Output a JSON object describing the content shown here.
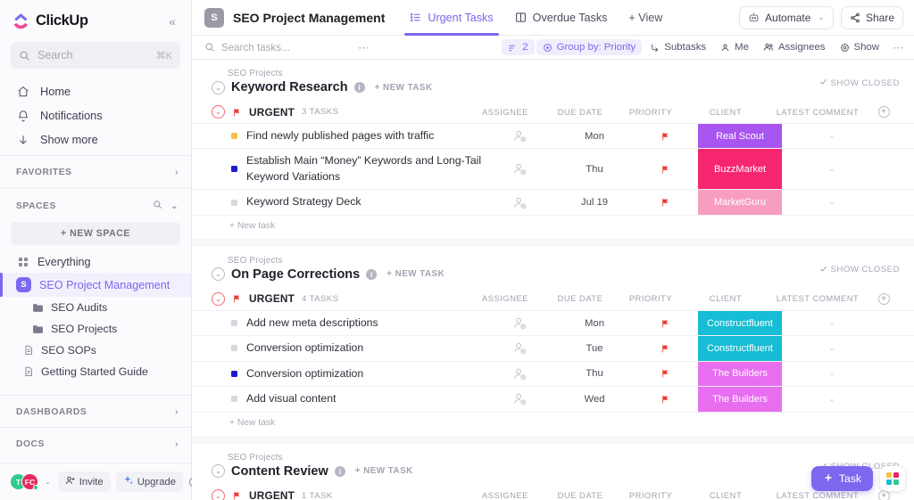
{
  "sidebar": {
    "brand": "ClickUp",
    "collapse_icon": "chevrons-left-icon",
    "search": {
      "placeholder": "Search",
      "shortcut": "⌘K",
      "icon": "search-icon"
    },
    "nav": [
      {
        "label": "Home",
        "icon": "home-icon"
      },
      {
        "label": "Notifications",
        "icon": "bell-icon"
      },
      {
        "label": "Show more",
        "icon": "arrow-down-icon"
      }
    ],
    "favorites": {
      "label": "FAVORITES",
      "chevron": "chevron-right-icon"
    },
    "spaces": {
      "label": "SPACES",
      "search_icon": "search-icon",
      "chevron": "chevron-down-icon",
      "new_space": "+ NEW SPACE",
      "items": [
        {
          "label": "Everything",
          "type": "grid",
          "badge": "",
          "active": false
        },
        {
          "label": "SEO Project Management",
          "type": "space",
          "badge": "S",
          "active": true
        },
        {
          "label": "SEO Audits",
          "type": "folder",
          "active": false
        },
        {
          "label": "SEO Projects",
          "type": "folder",
          "active": false
        },
        {
          "label": "SEO SOPs",
          "type": "doc",
          "active": false
        },
        {
          "label": "Getting Started Guide",
          "type": "doc",
          "active": false
        }
      ]
    },
    "dashboards": {
      "label": "DASHBOARDS",
      "chevron": "chevron-right-icon"
    },
    "docs": {
      "label": "DOCS",
      "chevron": "chevron-right-icon"
    },
    "bottom": {
      "avatars": [
        {
          "initials": "T",
          "color": "#2ecb8b"
        },
        {
          "initials": "FC",
          "color": "#e8275f"
        }
      ],
      "invite_label": "Invite",
      "invite_icon": "user-plus-icon",
      "upgrade_label": "Upgrade",
      "upgrade_icon": "sparkle-icon",
      "help_icon": "help-circle-icon"
    }
  },
  "topbar": {
    "project_badge": "S",
    "project_title": "SEO Project Management",
    "tabs": [
      {
        "label": "Urgent Tasks",
        "icon": "list-view-icon",
        "active": true
      },
      {
        "label": "Overdue Tasks",
        "icon": "board-view-icon",
        "active": false
      }
    ],
    "add_view": "+ View",
    "automate": {
      "label": "Automate",
      "icon": "robot-icon",
      "caret": "chevron-down-icon"
    },
    "share": {
      "label": "Share",
      "icon": "share-icon"
    }
  },
  "toolbar": {
    "search_placeholder": "Search tasks...",
    "search_icon": "search-icon",
    "more_icon": "ellipsis-icon",
    "chips": [
      {
        "label": "2",
        "icon": "filter-icon",
        "highlighted": true
      },
      {
        "label": "Group by: Priority",
        "icon": "layers-icon",
        "highlighted": true
      },
      {
        "label": "Subtasks",
        "icon": "subtask-icon",
        "highlighted": false
      },
      {
        "label": "Me",
        "icon": "person-icon",
        "highlighted": false
      },
      {
        "label": "Assignees",
        "icon": "people-icon",
        "highlighted": false
      },
      {
        "label": "Show",
        "icon": "eye-icon",
        "highlighted": false
      }
    ],
    "overflow_icon": "ellipsis-icon"
  },
  "columns": {
    "assignee": "ASSIGNEE",
    "due_date": "DUE DATE",
    "priority": "PRIORITY",
    "client": "CLIENT",
    "latest_comment": "LATEST COMMENT",
    "add_column_icon": "plus-circle-icon"
  },
  "labels": {
    "show_closed": "SHOW CLOSED",
    "show_closed_icon": "check-icon",
    "new_task_caps": "+ NEW TASK",
    "new_task": "+ New task",
    "info_icon": "info-icon",
    "collapse_icon": "chevron-down-circle-icon",
    "assignee_icon": "assignee-avatar-icon",
    "flag_icon": "flag-icon",
    "empty_comment": "-"
  },
  "status_colors": {
    "todo": "#d8d8e0",
    "in_progress": "#f5c542",
    "complete": "#1b1bd6"
  },
  "client_colors": {
    "Real Scout": "#a855f0",
    "BuzzMarket": "#f5266f",
    "MarketGuru": "#f79ec0",
    "Constructfluent": "#16bdd4",
    "The Builders": "#e86ef0"
  },
  "groups": [
    {
      "breadcrumb": "SEO Projects",
      "title": "Keyword Research",
      "priority_label": "URGENT",
      "task_count": "3 TASKS",
      "tasks": [
        {
          "name": "Find newly published pages with traffic",
          "status": "in_progress",
          "due": "Mon",
          "priority": "urgent",
          "client": "Real Scout",
          "comment": "-"
        },
        {
          "name": "Establish Main “Money” Keywords and Long-Tail Keyword Variations",
          "status": "complete",
          "due": "Thu",
          "priority": "urgent",
          "client": "BuzzMarket",
          "comment": "-"
        },
        {
          "name": "Keyword Strategy Deck",
          "status": "todo",
          "due": "Jul 19",
          "priority": "urgent",
          "client": "MarketGuru",
          "comment": "-"
        }
      ]
    },
    {
      "breadcrumb": "SEO Projects",
      "title": "On Page Corrections",
      "priority_label": "URGENT",
      "task_count": "4 TASKS",
      "tasks": [
        {
          "name": "Add new meta descriptions",
          "status": "todo",
          "due": "Mon",
          "priority": "urgent",
          "client": "Constructfluent",
          "comment": "-"
        },
        {
          "name": "Conversion optimization",
          "status": "todo",
          "due": "Tue",
          "priority": "urgent",
          "client": "Constructfluent",
          "comment": "-"
        },
        {
          "name": "Conversion optimization",
          "status": "complete",
          "due": "Thu",
          "priority": "urgent",
          "client": "The Builders",
          "comment": "-"
        },
        {
          "name": "Add visual content",
          "status": "todo",
          "due": "Wed",
          "priority": "urgent",
          "client": "The Builders",
          "comment": "-"
        }
      ]
    },
    {
      "breadcrumb": "SEO Projects",
      "title": "Content Review",
      "priority_label": "URGENT",
      "task_count": "1 TASK",
      "tasks": []
    }
  ],
  "fab": {
    "task_label": "Task",
    "task_icon": "plus-icon",
    "apps_icon": "apps-grid-icon",
    "apps_colors": [
      "#f5c542",
      "#e8275f",
      "#16bdd4",
      "#2ecb8b"
    ]
  }
}
